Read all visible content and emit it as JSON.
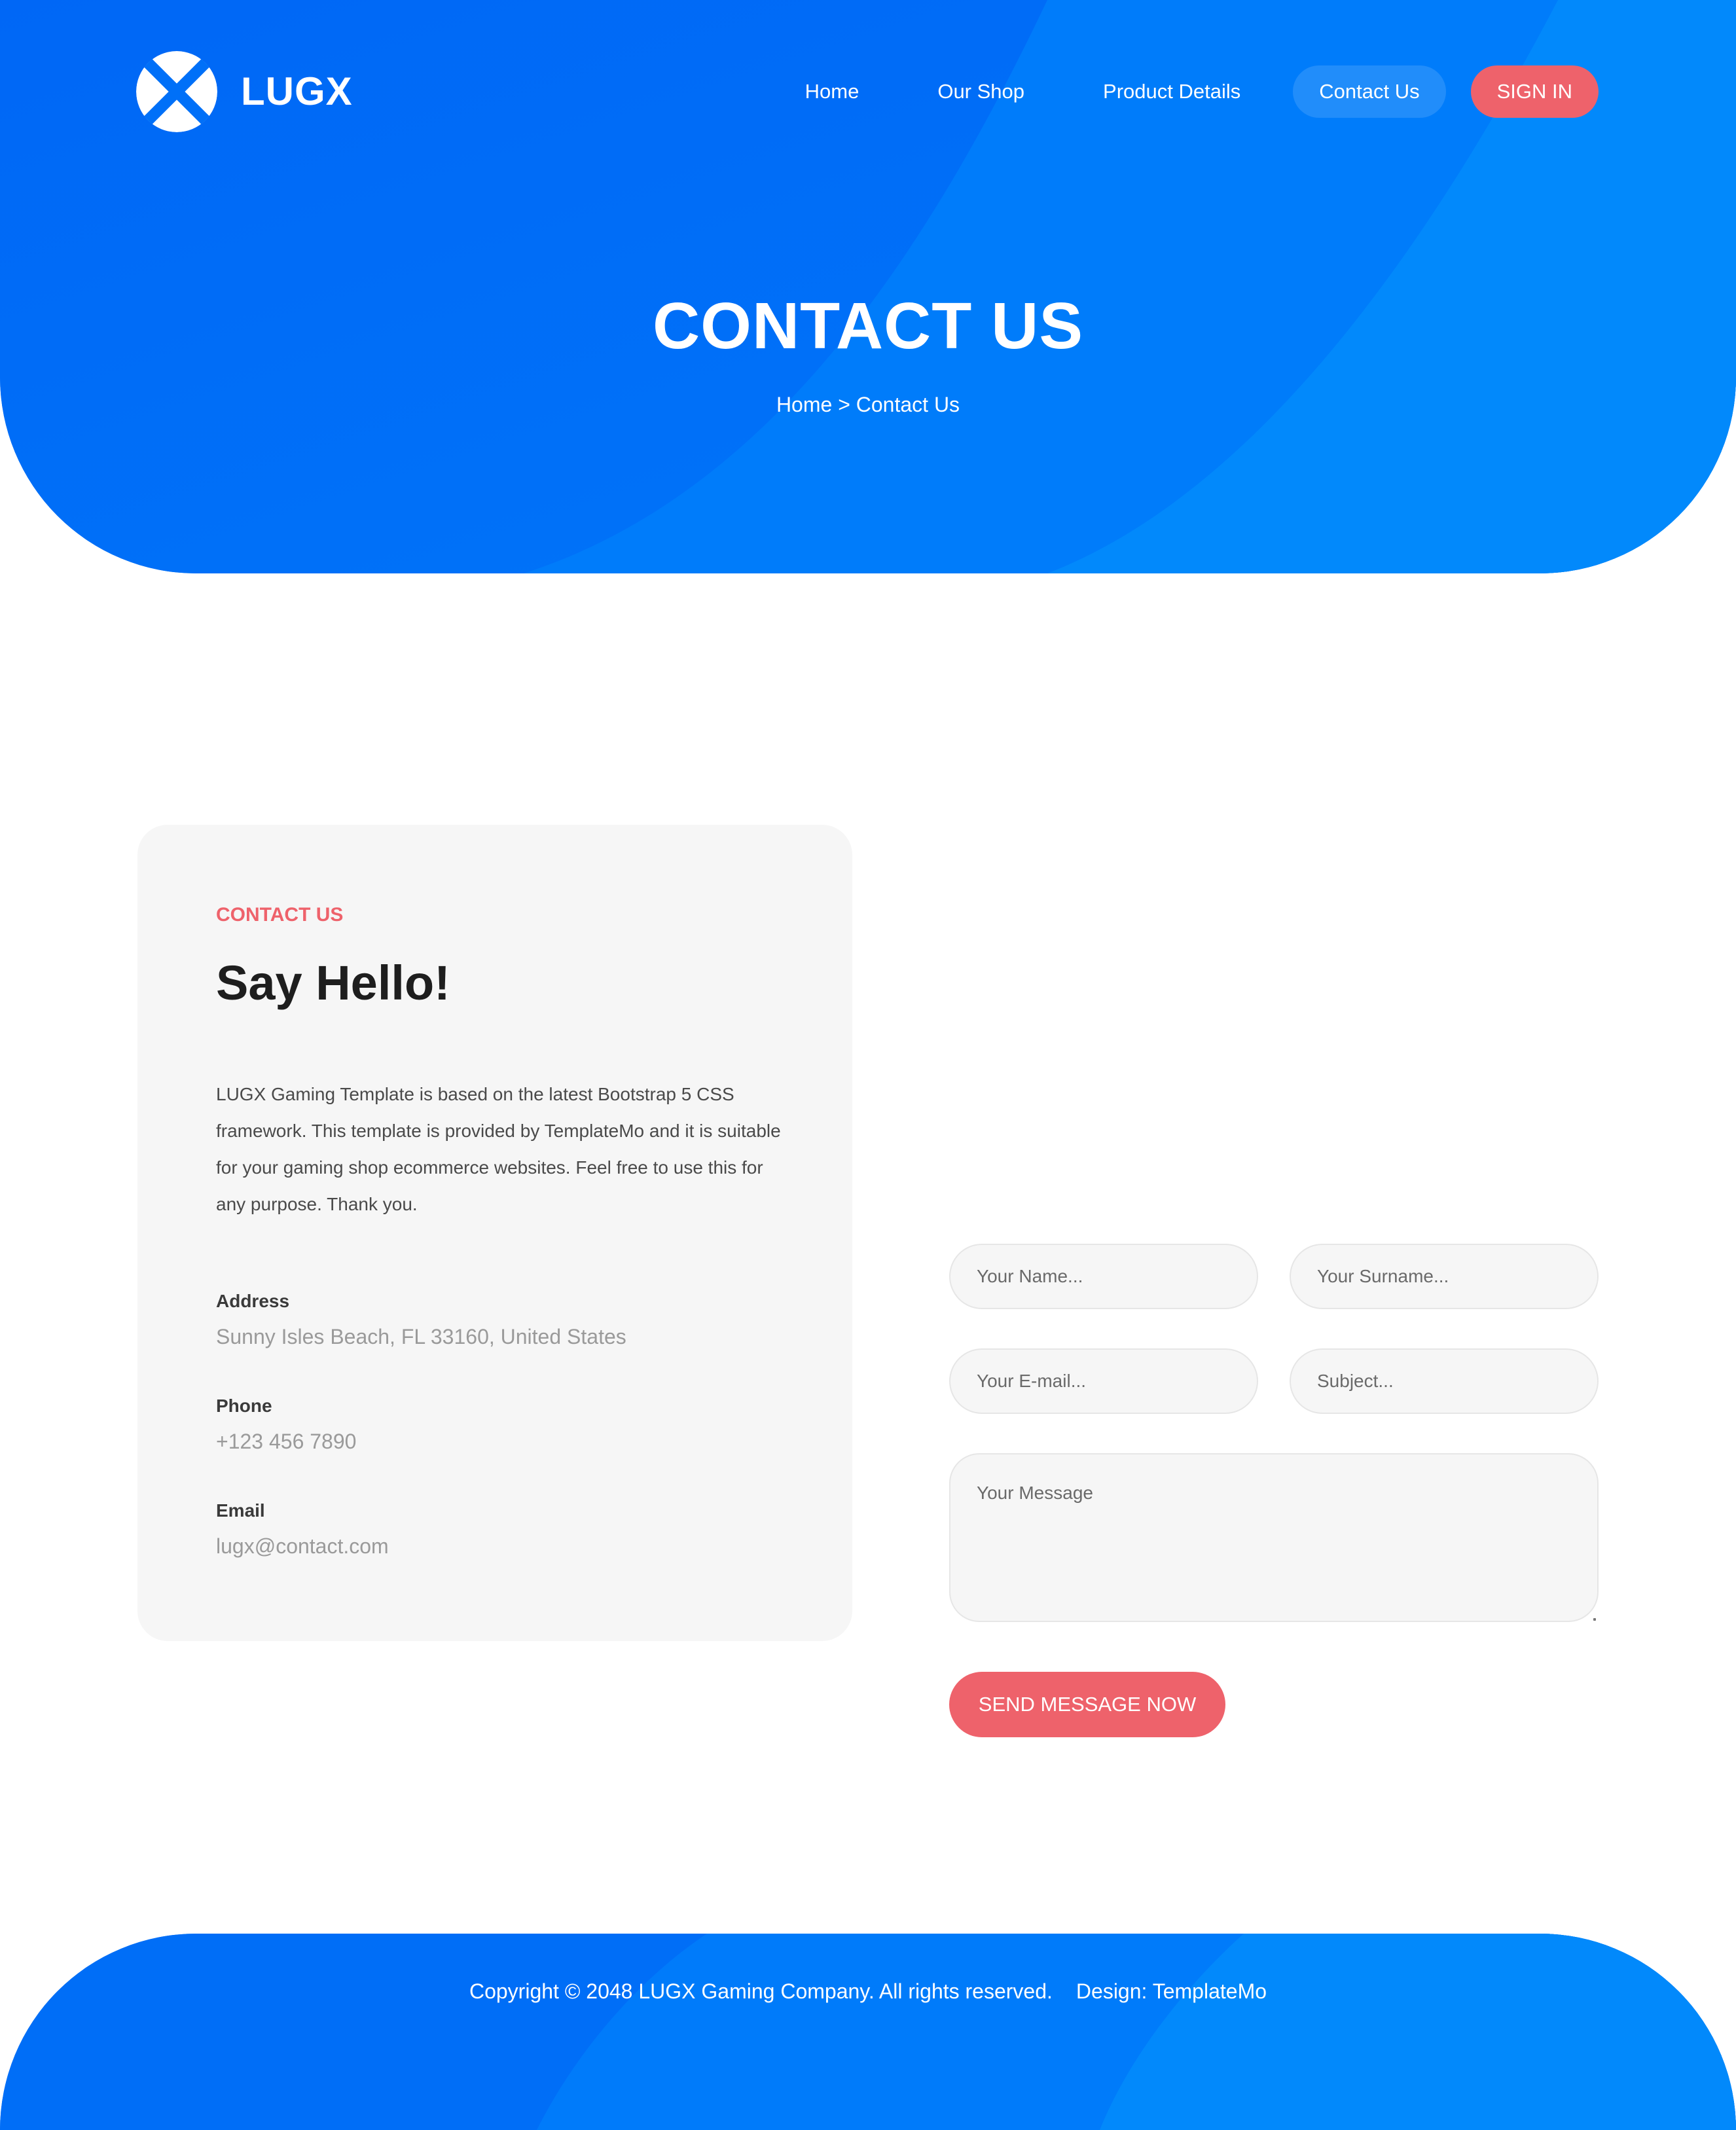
{
  "brand": {
    "name": "LUGX",
    "logo_icon": "lugx-x-logo-icon"
  },
  "nav": {
    "items": [
      {
        "label": "Home"
      },
      {
        "label": "Our Shop"
      },
      {
        "label": "Product Details"
      },
      {
        "label": "Contact Us",
        "active": true
      }
    ],
    "sign_in": "SIGN IN"
  },
  "hero": {
    "title": "CONTACT US",
    "breadcrumb": {
      "home": "Home",
      "separator": ">",
      "current": "Contact Us"
    }
  },
  "contact_card": {
    "eyebrow": "CONTACT US",
    "headline": "Say Hello!",
    "intro": "LUGX Gaming Template is based on the latest Bootstrap 5 CSS framework. This template is provided by TemplateMo and it is suitable for your gaming shop ecommerce websites. Feel free to use this for any purpose. Thank you.",
    "address": {
      "label": "Address",
      "value": "Sunny Isles Beach, FL 33160, United States"
    },
    "phone": {
      "label": "Phone",
      "value": "+123 456 7890"
    },
    "email": {
      "label": "Email",
      "value": "lugx@contact.com"
    }
  },
  "form": {
    "name": {
      "placeholder": "Your Name...",
      "value": ""
    },
    "surname": {
      "placeholder": "Your Surname...",
      "value": ""
    },
    "email": {
      "placeholder": "Your E-mail...",
      "value": ""
    },
    "subject": {
      "placeholder": "Subject...",
      "value": ""
    },
    "message": {
      "placeholder": "Your Message",
      "value": ""
    },
    "submit_label": "SEND MESSAGE NOW"
  },
  "footer": {
    "copyright": "Copyright © 2048 LUGX Gaming Company. All rights reserved.",
    "design_credit": "Design: TemplateMo"
  },
  "colors": {
    "primary_blue": "#0071f8",
    "light_blue": "#0289fb",
    "accent_red": "#ee626b",
    "card_bg": "#f6f6f6",
    "heading_dark": "#1e1e1e",
    "muted_text": "#9a9a9a"
  }
}
